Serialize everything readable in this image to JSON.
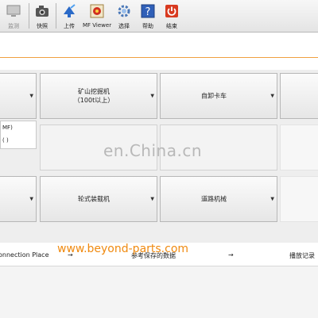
{
  "toolbar": {
    "items": [
      {
        "label": "监测",
        "icon": "monitor-icon"
      },
      {
        "label": "快照",
        "icon": "camera-icon"
      },
      {
        "label": "上传",
        "icon": "upload-icon"
      },
      {
        "label": "MF Viewer",
        "icon": "mf-viewer-icon"
      },
      {
        "label": "选择",
        "icon": "gear-icon"
      },
      {
        "label": "帮助",
        "icon": "help-icon"
      },
      {
        "label": "结束",
        "icon": "power-icon"
      }
    ]
  },
  "tiles": {
    "row1": [
      "",
      "矿山挖掘机\n（100t以上）",
      "自卸卡车",
      ""
    ],
    "row2": [
      "",
      "",
      "",
      ""
    ],
    "row3": [
      "",
      "轮式装载机",
      "道路机械",
      ""
    ]
  },
  "popup": {
    "line1": "MF)",
    "line2": "(    )"
  },
  "watermark": "en.China.cn",
  "url_overlay": "www.beyond-parts.com",
  "footer": {
    "connection_place": "onnection Place",
    "arrow1": "→",
    "reference_data": "参考保存的数据",
    "arrow2": "→",
    "playback": "播放记录"
  },
  "colors": {
    "accent": "#f08a10",
    "separator": "#f0a040"
  }
}
